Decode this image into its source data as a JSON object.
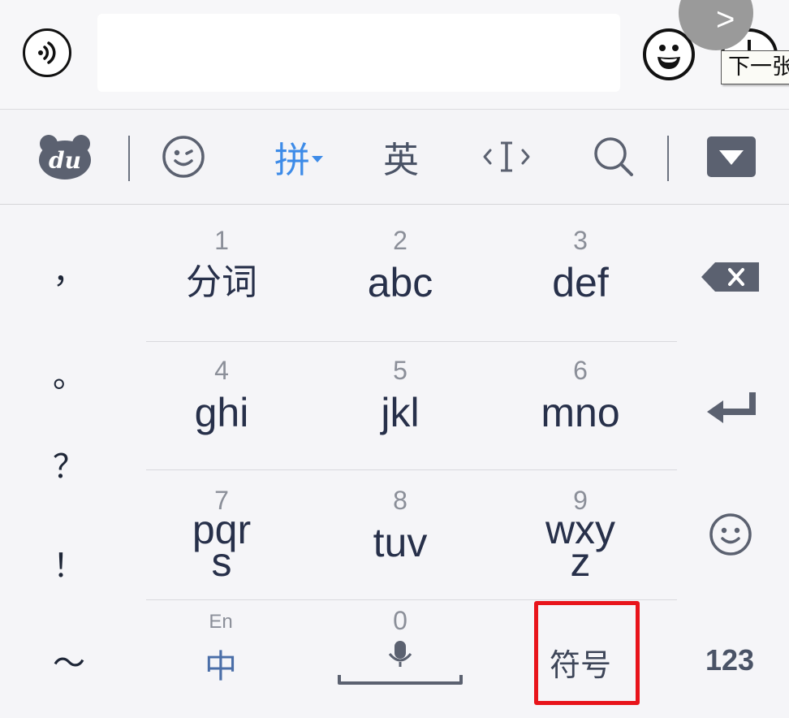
{
  "input_bar": {
    "text_value": "",
    "next_arrow": ">",
    "tooltip": "下一张"
  },
  "toolbar": {
    "logo_text": "du",
    "pinyin_label": "拼",
    "english_label": "英",
    "icons": [
      "du-bear-logo-icon",
      "emoji-smile-icon",
      "cursor-move-icon",
      "search-icon",
      "collapse-keyboard-icon"
    ]
  },
  "punctuation": [
    "，",
    "。",
    "？",
    "！",
    "～"
  ],
  "keys": [
    {
      "number": "1",
      "label": "分词"
    },
    {
      "number": "2",
      "label": "abc"
    },
    {
      "number": "3",
      "label": "def"
    },
    {
      "number": "4",
      "label": "ghi"
    },
    {
      "number": "5",
      "label": "jkl"
    },
    {
      "number": "6",
      "label": "mno"
    },
    {
      "number": "7",
      "label": "pqr",
      "label2": "s"
    },
    {
      "number": "8",
      "label": "tuv"
    },
    {
      "number": "9",
      "label": "wxy",
      "label2": "z"
    }
  ],
  "bottom_row": {
    "lang_small": "En",
    "lang_main": "中",
    "zero": "0",
    "symbol": "符号",
    "numeric": "123"
  },
  "colors": {
    "accent_blue": "#3d8be8",
    "key_text": "#27304a",
    "number_text": "#8b8f99",
    "highlight_red": "#e8141b",
    "icon_dark": "#5b6170"
  }
}
